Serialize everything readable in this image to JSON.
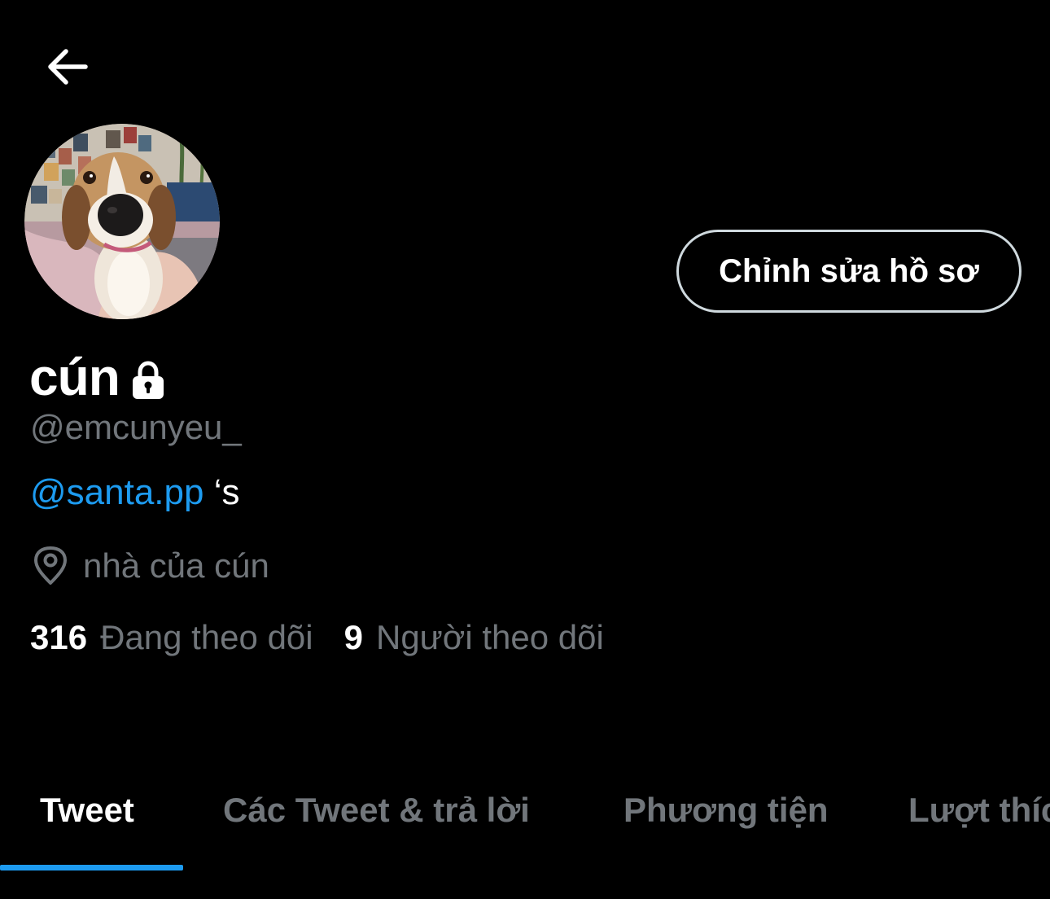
{
  "header": {
    "back_icon": "arrow-left-icon"
  },
  "profile": {
    "avatar_icon": "dog-avatar-photo",
    "display_name": "cún",
    "lock_icon": "lock-icon",
    "handle": "@emcunyeu_",
    "bio_mention": "@santa.pp",
    "bio_suffix": " ‘s",
    "location_icon": "location-pin-icon",
    "location": "nhà của cún",
    "edit_button_label": "Chỉnh sửa hồ sơ"
  },
  "stats": {
    "following_count": "316",
    "following_label": "Đang theo dõi",
    "followers_count": "9",
    "followers_label": "Người theo dõi"
  },
  "tabs": [
    {
      "label": "Tweet",
      "active": true
    },
    {
      "label": "Các Tweet & trả lời",
      "active": false
    },
    {
      "label": "Phương tiện",
      "active": false
    },
    {
      "label": "Lượt thích",
      "active": false
    }
  ],
  "colors": {
    "background": "#000000",
    "accent": "#1d9bf0",
    "secondary_text": "#71767b",
    "button_border": "#cfd9de"
  }
}
